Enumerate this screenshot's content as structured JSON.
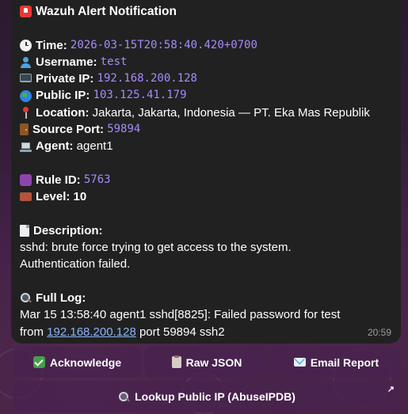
{
  "message": {
    "title": "Wazuh Alert Notification",
    "time_label": "Time:",
    "time_value": "2026-03-15T20:58:40.420+0700",
    "username_label": "Username:",
    "username_value": "test",
    "private_ip_label": "Private IP:",
    "private_ip_value": "192.168.200.128",
    "public_ip_label": "Public IP:",
    "public_ip_value": "103.125.41.179",
    "location_label": "Location:",
    "location_value": "Jakarta, Jakarta, Indonesia — PT. Eka Mas Republik",
    "source_port_label": "Source Port:",
    "source_port_value": "59894",
    "agent_label": "Agent:",
    "agent_value": "agent1",
    "rule_id_label": "Rule ID:",
    "rule_id_value": "5763",
    "level_label": "Level:",
    "level_value": "10",
    "description_label": "Description:",
    "description_line1": "sshd: brute force trying to get access to the system.",
    "description_line2": "Authentication failed.",
    "full_log_label": "Full Log:",
    "full_log_line1": "Mar 15 13:58:40 agent1 sshd[8825]: Failed password for test",
    "full_log_from": "from",
    "full_log_link": "192.168.200.128",
    "full_log_rest": "port 59894 ssh2",
    "timestamp": "20:59"
  },
  "buttons": {
    "acknowledge": "Acknowledge",
    "raw_json": "Raw JSON",
    "email_report": "Email Report",
    "lookup": "Lookup Public IP (AbuseIPDB)",
    "lookup_arrow": "↗"
  },
  "icons": {
    "title": "alert-siren-icon",
    "time": "clock-icon",
    "username": "user-icon",
    "private_ip": "desktop-computer-icon",
    "public_ip": "globe-icon",
    "location": "pin-icon",
    "source_port": "door-icon",
    "agent": "laptop-icon",
    "rule_id": "id-badge-icon",
    "level": "brick-icon",
    "description": "document-icon",
    "full_log": "magnifier-icon"
  },
  "colors": {
    "bubble_bg": "#212121",
    "mono_value": "#a78bfa",
    "link": "#8ab4f8",
    "button_bg": "#48224e"
  }
}
